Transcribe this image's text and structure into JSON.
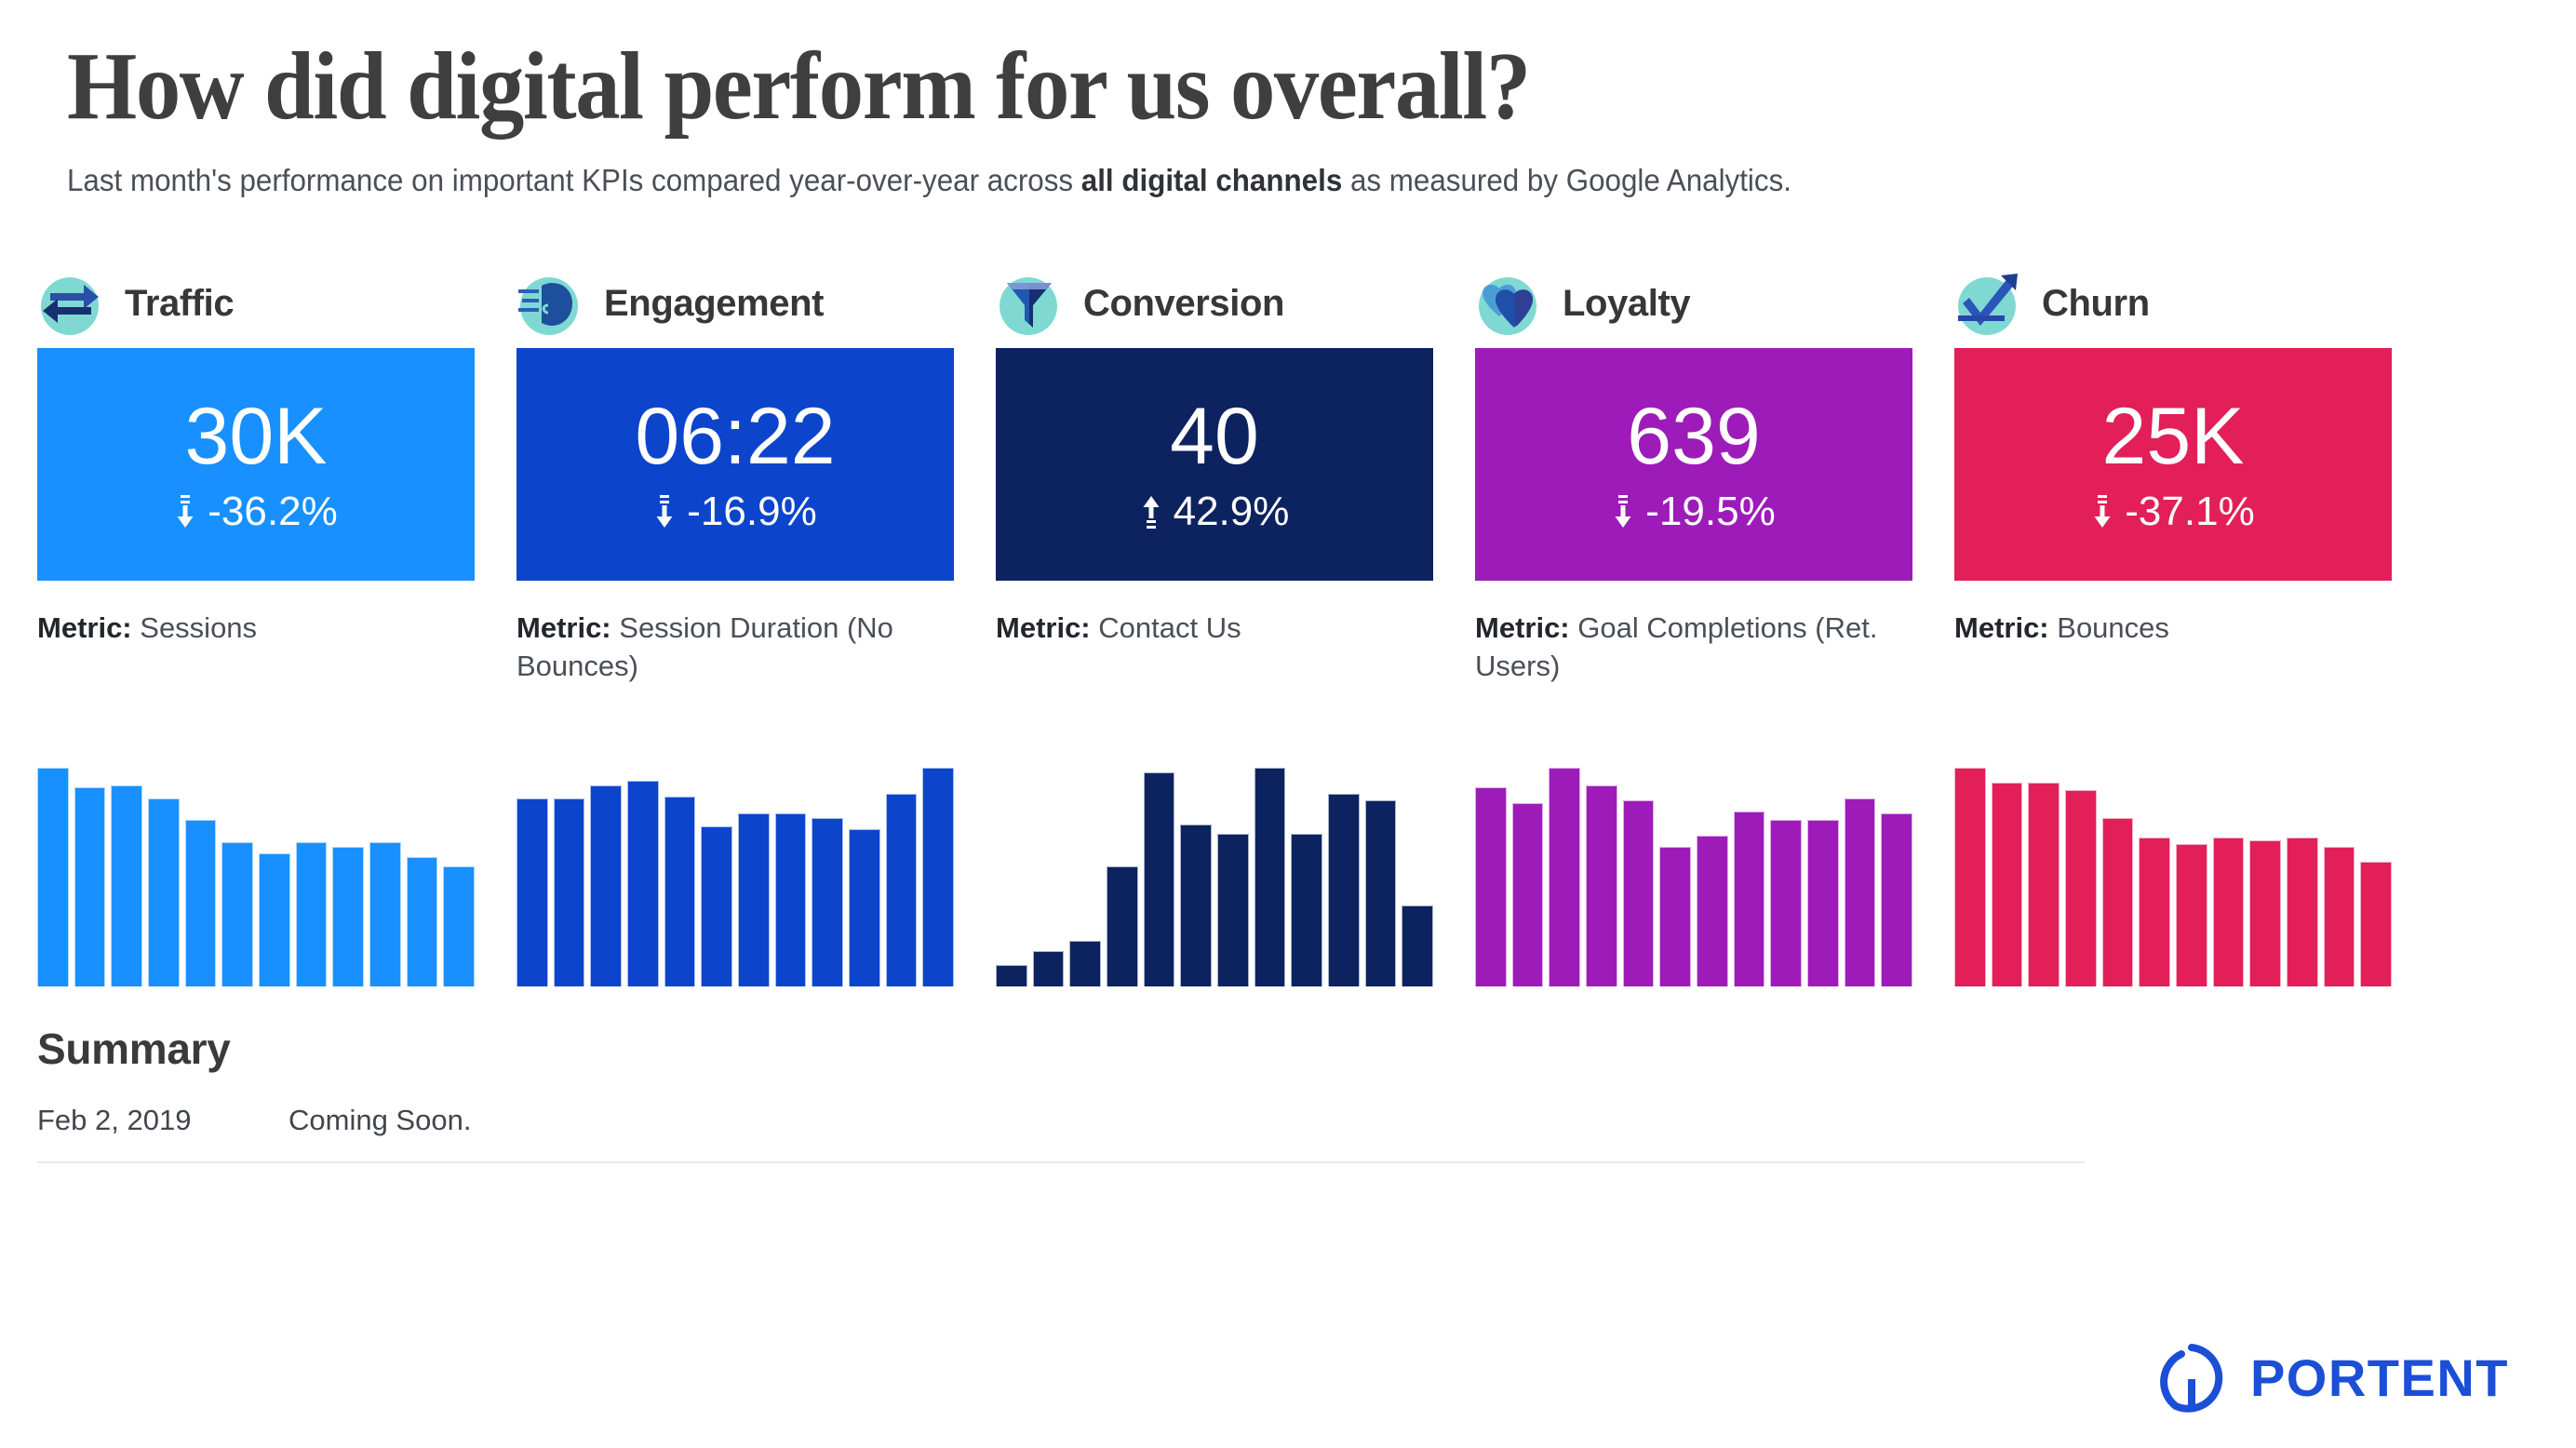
{
  "header": {
    "title": "How did digital perform for us overall?",
    "subtitle_before": "Last month's performance on important KPIs compared year-over-year across ",
    "subtitle_bold": "all digital channels",
    "subtitle_after": " as measured by Google Analytics."
  },
  "kpis": [
    {
      "name": "Traffic",
      "icon": "exchange-arrows-icon",
      "value": "30K",
      "delta": "-36.2%",
      "direction": "down",
      "metric_label": "Metric:",
      "metric_value": "Sessions",
      "card_color": "#1890ff",
      "bar_color": "#1890ff"
    },
    {
      "name": "Engagement",
      "icon": "head-profile-icon",
      "value": "06:22",
      "delta": "-16.9%",
      "direction": "down",
      "metric_label": "Metric:",
      "metric_value": "Session Duration (No Bounces)",
      "card_color": "#0c45cc",
      "bar_color": "#0c45cc"
    },
    {
      "name": "Conversion",
      "icon": "funnel-icon",
      "value": "40",
      "delta": "42.9%",
      "direction": "up",
      "metric_label": "Metric:",
      "metric_value": "Contact Us",
      "card_color": "#0d2360",
      "bar_color": "#0d2360"
    },
    {
      "name": "Loyalty",
      "icon": "double-heart-icon",
      "value": "639",
      "delta": "-19.5%",
      "direction": "down",
      "metric_label": "Metric:",
      "metric_value": "Goal Completions (Ret. Users)",
      "card_color": "#9d1cb9",
      "bar_color": "#9d1cb9"
    },
    {
      "name": "Churn",
      "icon": "check-arrow-icon",
      "value": "25K",
      "delta": "-37.1%",
      "direction": "down",
      "metric_label": "Metric:",
      "metric_value": "Bounces",
      "card_color": "#e21f59",
      "bar_color": "#e21f59"
    }
  ],
  "summary": {
    "title": "Summary",
    "rows": [
      {
        "date": "Feb 2, 2019",
        "text": "Coming Soon."
      }
    ]
  },
  "brand": {
    "word": "PORTENT",
    "mark": "portent-circle-logo",
    "color": "#1a4fd6"
  },
  "chart_data": [
    {
      "type": "bar",
      "title": "Traffic",
      "ylabel": "Sessions",
      "xlabel": "",
      "grid": false,
      "legend": "none",
      "ylim": [
        0,
        100
      ],
      "categories": [
        "1",
        "2",
        "3",
        "4",
        "5",
        "6",
        "7",
        "8",
        "9",
        "10",
        "11",
        "12"
      ],
      "values": [
        100,
        91,
        92,
        86,
        76,
        66,
        61,
        66,
        64,
        66,
        59,
        55
      ],
      "color": "#1890ff"
    },
    {
      "type": "bar",
      "title": "Engagement",
      "ylabel": "Session Duration (No Bounces)",
      "xlabel": "",
      "grid": false,
      "legend": "none",
      "ylim": [
        0,
        100
      ],
      "categories": [
        "1",
        "2",
        "3",
        "4",
        "5",
        "6",
        "7",
        "8",
        "9",
        "10",
        "11",
        "12"
      ],
      "values": [
        86,
        86,
        92,
        94,
        87,
        73,
        79,
        79,
        77,
        72,
        88,
        100
      ],
      "color": "#0c45cc"
    },
    {
      "type": "bar",
      "title": "Conversion",
      "ylabel": "Contact Us",
      "xlabel": "",
      "grid": false,
      "legend": "none",
      "ylim": [
        0,
        100
      ],
      "categories": [
        "1",
        "2",
        "3",
        "4",
        "5",
        "6",
        "7",
        "8",
        "9",
        "10",
        "11",
        "12"
      ],
      "values": [
        10,
        16,
        21,
        55,
        98,
        74,
        70,
        100,
        70,
        88,
        85,
        37
      ],
      "color": "#0d2360"
    },
    {
      "type": "bar",
      "title": "Loyalty",
      "ylabel": "Goal Completions (Ret. Users)",
      "xlabel": "",
      "grid": false,
      "legend": "none",
      "ylim": [
        0,
        100
      ],
      "categories": [
        "1",
        "2",
        "3",
        "4",
        "5",
        "6",
        "7",
        "8",
        "9",
        "10",
        "11",
        "12"
      ],
      "values": [
        91,
        84,
        100,
        92,
        85,
        64,
        69,
        80,
        76,
        76,
        86,
        79
      ],
      "color": "#9d1cb9"
    },
    {
      "type": "bar",
      "title": "Churn",
      "ylabel": "Bounces",
      "xlabel": "",
      "grid": false,
      "legend": "none",
      "ylim": [
        0,
        100
      ],
      "categories": [
        "1",
        "2",
        "3",
        "4",
        "5",
        "6",
        "7",
        "8",
        "9",
        "10",
        "11",
        "12"
      ],
      "values": [
        100,
        93,
        93,
        90,
        77,
        68,
        65,
        68,
        67,
        68,
        64,
        57
      ],
      "color": "#e21f59"
    }
  ]
}
